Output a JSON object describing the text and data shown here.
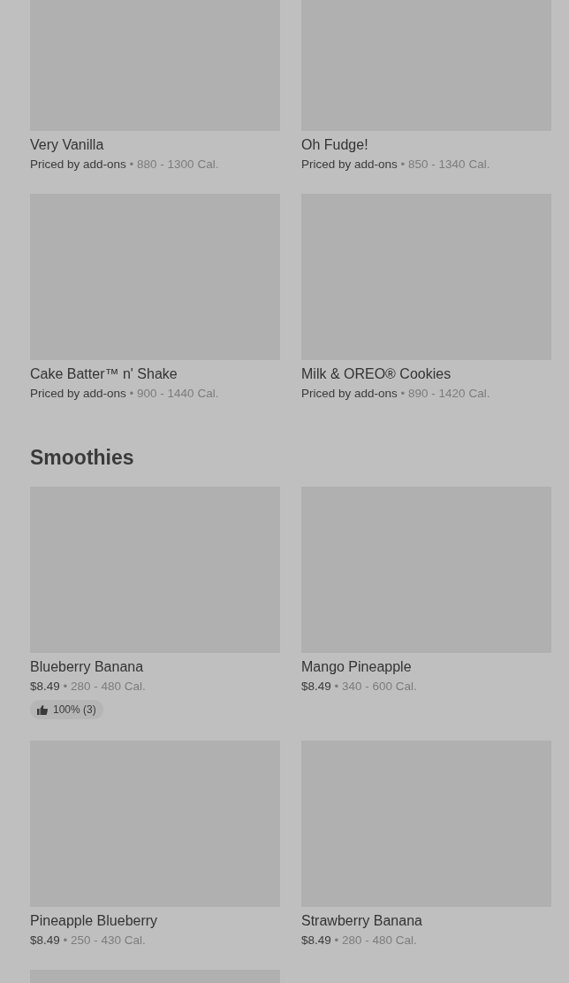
{
  "sections": [
    {
      "items": [
        {
          "kind": "item",
          "name": "Very Vanilla",
          "price": "Priced by add-ons",
          "separator": "•",
          "calories": "880 - 1300 Cal."
        },
        {
          "kind": "item",
          "name": "Oh Fudge!",
          "price": "Priced by add-ons",
          "separator": "•",
          "calories": "850 - 1340 Cal."
        },
        {
          "kind": "item",
          "name": "Cake Batter™ n' Shake",
          "price": "Priced by add-ons",
          "separator": "•",
          "calories": "900 - 1440 Cal."
        },
        {
          "kind": "item",
          "name": "Milk & OREO® Cookies",
          "price": "Priced by add-ons",
          "separator": "•",
          "calories": "890 - 1420 Cal."
        }
      ]
    },
    {
      "title": "Smoothies",
      "items": [
        {
          "kind": "item",
          "name": "Blueberry Banana",
          "price": "$8.49",
          "separator": "•",
          "calories": "280 - 480 Cal.",
          "rating": "100% (3)"
        },
        {
          "kind": "item",
          "name": "Mango Pineapple",
          "price": "$8.49",
          "separator": "•",
          "calories": "340 - 600 Cal."
        },
        {
          "kind": "item",
          "name": "Pineapple Blueberry",
          "price": "$8.49",
          "separator": "•",
          "calories": "250 - 430 Cal."
        },
        {
          "kind": "item",
          "name": "Strawberry Banana",
          "price": "$8.49",
          "separator": "•",
          "calories": "280 - 480 Cal."
        },
        {
          "kind": "picture"
        }
      ]
    }
  ]
}
